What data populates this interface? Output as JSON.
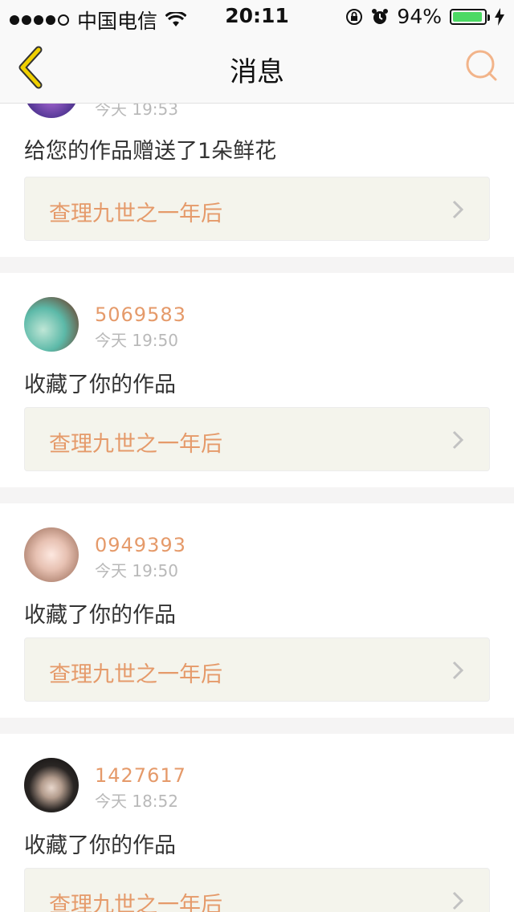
{
  "status_bar": {
    "carrier": "中国电信",
    "time": "20:11",
    "battery_percent": "94%",
    "battery_level": 0.94,
    "signal_dots_filled": 4,
    "icons": [
      "wifi-icon",
      "rotation-lock-icon",
      "alarm-icon",
      "battery-icon",
      "charging-icon"
    ]
  },
  "navbar": {
    "title": "消息",
    "back_icon": "chevron-left-icon",
    "search_icon": "search-icon",
    "accent_color": "#e59a6a",
    "back_color": "#f0d000"
  },
  "messages": [
    {
      "username": "",
      "time": "今天 19:53",
      "action": "给您的作品赠送了1朵鲜花",
      "work_title": "查理九世之一年后"
    },
    {
      "username": "5069583",
      "time": "今天 19:50",
      "action": "收藏了你的作品",
      "work_title": "查理九世之一年后"
    },
    {
      "username": "0949393",
      "time": "今天 19:50",
      "action": "收藏了你的作品",
      "work_title": "查理九世之一年后"
    },
    {
      "username": "1427617",
      "time": "今天 18:52",
      "action": "收藏了你的作品",
      "work_title": "查理九世之一年后"
    }
  ]
}
